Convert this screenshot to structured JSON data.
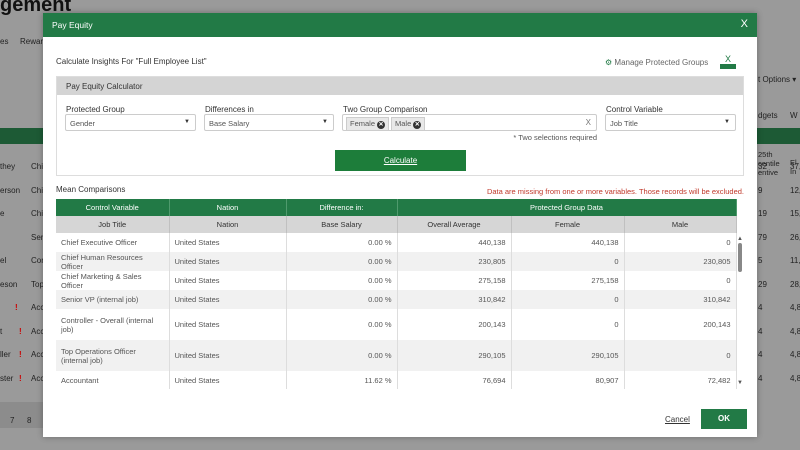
{
  "background": {
    "title": "gement",
    "nav": [
      "es",
      "Rewar"
    ],
    "right_options": "t Options ▾",
    "right_tabs": [
      "dgets",
      "W"
    ],
    "right_headers": [
      "25th\ncentile\nentive",
      "El\nIn"
    ],
    "left_names": [
      "they",
      "erson",
      "e",
      "",
      "el",
      "eson",
      "",
      "t",
      "ller",
      "ster"
    ],
    "left_col2": [
      "Chi",
      "Chi",
      "Chi",
      "Sen",
      "Con",
      "Top",
      "Acc",
      "Acc",
      "Acc",
      "Acc"
    ],
    "right_c1": [
      "32",
      "9",
      "19",
      "79",
      "5",
      "29",
      "4",
      "4",
      "4",
      "4"
    ],
    "right_c2": [
      "37,",
      "12,",
      "15,",
      "26,",
      "11,",
      "28,",
      "4,8",
      "4,8",
      "4,8",
      "4,8"
    ],
    "pages": [
      "7",
      "8"
    ]
  },
  "modal": {
    "title": "Pay Equity",
    "close": "X",
    "insights_for": "Calculate Insights For \"Full Employee List\"",
    "manage_groups": "Manage Protected Groups",
    "excel_label": "X",
    "calculator": {
      "title": "Pay Equity Calculator",
      "protected_group": {
        "label": "Protected Group",
        "value": "Gender"
      },
      "differences_in": {
        "label": "Differences in",
        "value": "Base Salary"
      },
      "two_group": {
        "label": "Two Group Comparison",
        "chips": [
          "Female",
          "Male"
        ],
        "clear": "X",
        "note": "* Two selections required"
      },
      "control_variable": {
        "label": "Control Variable",
        "value": "Job Title"
      },
      "calculate": "Calculate"
    },
    "mean_comparisons": "Mean Comparisons",
    "warning": "Data are missing from one or more variables. Those records will be excluded.",
    "warning_color": "#c0392b",
    "table": {
      "group_headers": [
        "Control Variable",
        "Nation",
        "Difference in:",
        "Protected Group Data"
      ],
      "sub_headers": [
        "Job Title",
        "Nation",
        "Base Salary",
        "Overall Average",
        "Female",
        "Male"
      ],
      "rows": [
        [
          "Chief Executive Officer",
          "United States",
          "0.00 %",
          "440,138",
          "440,138",
          "0"
        ],
        [
          "Chief Human Resources Officer",
          "United States",
          "0.00 %",
          "230,805",
          "0",
          "230,805"
        ],
        [
          "Chief Marketing & Sales Officer",
          "United States",
          "0.00 %",
          "275,158",
          "275,158",
          "0"
        ],
        [
          "Senior VP (internal job)",
          "United States",
          "0.00 %",
          "310,842",
          "0",
          "310,842"
        ],
        [
          "Controller - Overall (internal job)",
          "United States",
          "0.00 %",
          "200,143",
          "0",
          "200,143"
        ],
        [
          "Top Operations Officer (internal job)",
          "United States",
          "0.00 %",
          "290,105",
          "290,105",
          "0"
        ],
        [
          "Accountant",
          "United States",
          "11.62 %",
          "76,694",
          "80,907",
          "72,482"
        ]
      ]
    },
    "cancel": "Cancel",
    "ok": "OK",
    "accent": "#227a46"
  }
}
